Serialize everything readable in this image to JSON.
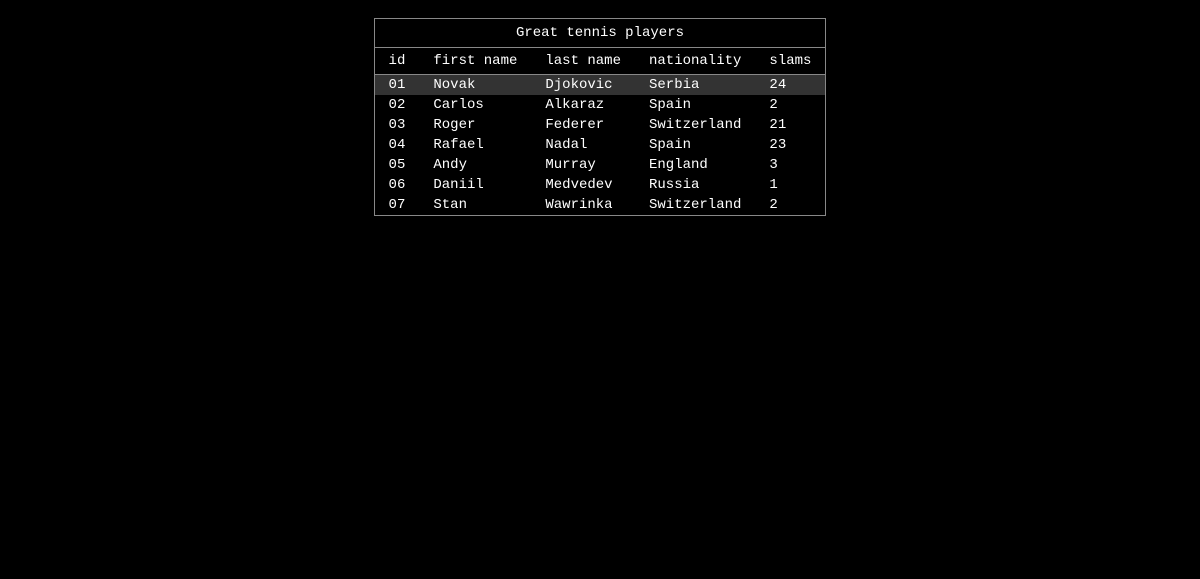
{
  "table": {
    "title": "Great tennis players",
    "columns": [
      "id",
      "first name",
      "last name",
      "nationality",
      "slams"
    ],
    "rows": [
      {
        "id": "01",
        "first_name": "Novak",
        "last_name": "Djokovic",
        "nationality": "Serbia",
        "slams": "24",
        "highlighted": true
      },
      {
        "id": "02",
        "first_name": "Carlos",
        "last_name": "Alkaraz",
        "nationality": "Spain",
        "slams": "2",
        "highlighted": false
      },
      {
        "id": "03",
        "first_name": "Roger",
        "last_name": "Federer",
        "nationality": "Switzerland",
        "slams": "21",
        "highlighted": false
      },
      {
        "id": "04",
        "first_name": "Rafael",
        "last_name": "Nadal",
        "nationality": "Spain",
        "slams": "23",
        "highlighted": false
      },
      {
        "id": "05",
        "first_name": "Andy",
        "last_name": "Murray",
        "nationality": "England",
        "slams": "3",
        "highlighted": false
      },
      {
        "id": "06",
        "first_name": "Daniil",
        "last_name": "Medvedev",
        "nationality": "Russia",
        "slams": "1",
        "highlighted": false
      },
      {
        "id": "07",
        "first_name": "Stan",
        "last_name": "Wawrinka",
        "nationality": "Switzerland",
        "slams": "2",
        "highlighted": false
      }
    ]
  }
}
